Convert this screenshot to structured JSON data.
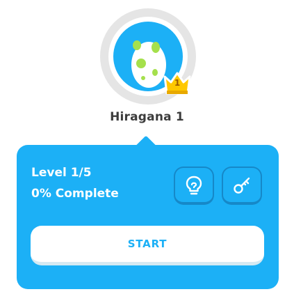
{
  "skill": {
    "title": "Hiragana 1",
    "crown_level": "1",
    "icon": "egg-icon",
    "progress_ring": 0
  },
  "popover": {
    "level_text": "Level 1/5",
    "complete_text": "0% Complete",
    "tips_icon": "lightbulb-icon",
    "key_icon": "key-icon",
    "start_label": "START"
  },
  "colors": {
    "accent": "#1cb0f6",
    "accent_dark": "#1688c8",
    "ring_gray": "#e5e5e5",
    "egg_white": "#ffffff",
    "egg_spots": "#a5e04c",
    "crown_gold": "#ffc800",
    "title_text": "#3c3c3c"
  }
}
